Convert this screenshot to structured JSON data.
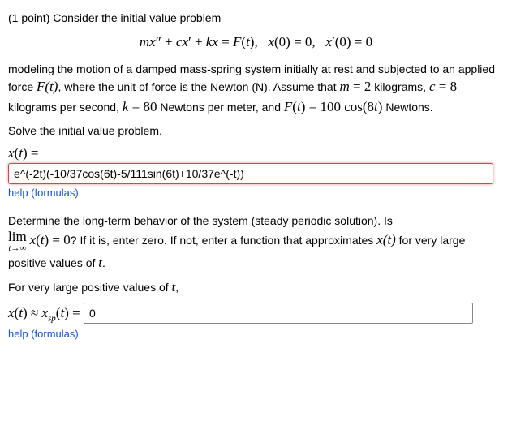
{
  "points_label": "(1 point) ",
  "intro": "Consider the initial value problem",
  "equation": "mx″ + cx′ + kx = F(t),   x(0) = 0,   x′(0) = 0",
  "body1": "modeling the motion of a damped mass-spring system initially at rest and subjected to an applied force ",
  "Ft": "F(t)",
  "body2": ", where the unit of force is the Newton (N). Assume that ",
  "m_eq": "m = 2",
  "body3": " kilograms, ",
  "c_eq": "c = 8",
  "body4": " kilograms per second, ",
  "k_eq": "k = 80",
  "body5": " Newtons per meter, and ",
  "Ft_eq": "F(t) = 100 cos(8t)",
  "body6": " Newtons.",
  "solve_prompt": "Solve the initial value problem.",
  "xt_label": "x(t) =",
  "answer1_value": "e^(-2t)(-10/37cos(6t)-5/111sin(6t)+10/37e^(-t))",
  "help_text": "help (formulas)",
  "long_term_intro": "Determine the long-term behavior of the system (steady periodic solution). Is ",
  "lim_top": "lim",
  "lim_bot": "t→∞",
  "lim_expr": " x(t) = 0",
  "long_term_rest": "? If it is, enter zero. If not, enter a function that approximates ",
  "xt_inline": "x(t)",
  "long_term_tail": " for very large positive values of ",
  "t_var": "t",
  "period_end": ".",
  "for_large": "For very large positive values of ",
  "comma": ",",
  "xsp_label": "x(t) ≈ x",
  "sp_sub": "sp",
  "xsp_tail": "(t) = ",
  "answer2_value": "0"
}
